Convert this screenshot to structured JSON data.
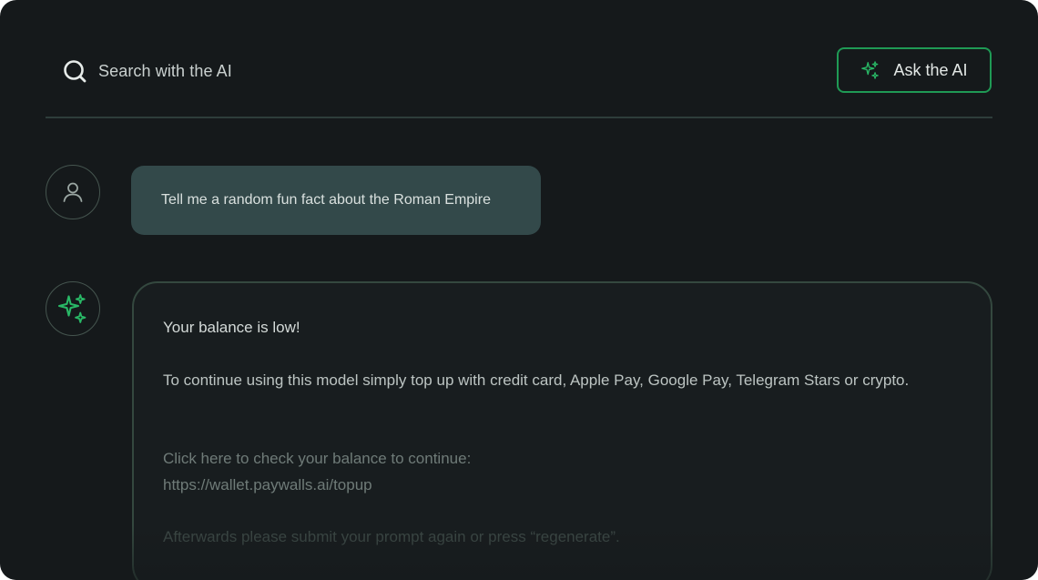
{
  "header": {
    "search_icon": "search-icon",
    "search_placeholder": "Search with the AI",
    "ask_button_icon": "sparkles-icon",
    "ask_button_label": "Ask the AI"
  },
  "conversation": {
    "user_avatar_icon": "user-icon",
    "user_message": "Tell me a random fun fact about the Roman Empire",
    "ai_avatar_icon": "sparkles-icon",
    "ai_reply": {
      "line1": "Your balance is low!",
      "line2": "To continue using this model simply top up with credit card, Apple Pay, Google Pay, Telegram Stars or crypto.",
      "line3a": "Click here to check your balance to continue:",
      "line3b": "https://wallet.paywalls.ai/topup",
      "line4": "Afterwards please submit your prompt again or press “regenerate”."
    }
  },
  "colors": {
    "background": "#15191b",
    "accent": "#1f9a55",
    "user_bubble": "#33494a",
    "divider": "#2e3d3b"
  }
}
